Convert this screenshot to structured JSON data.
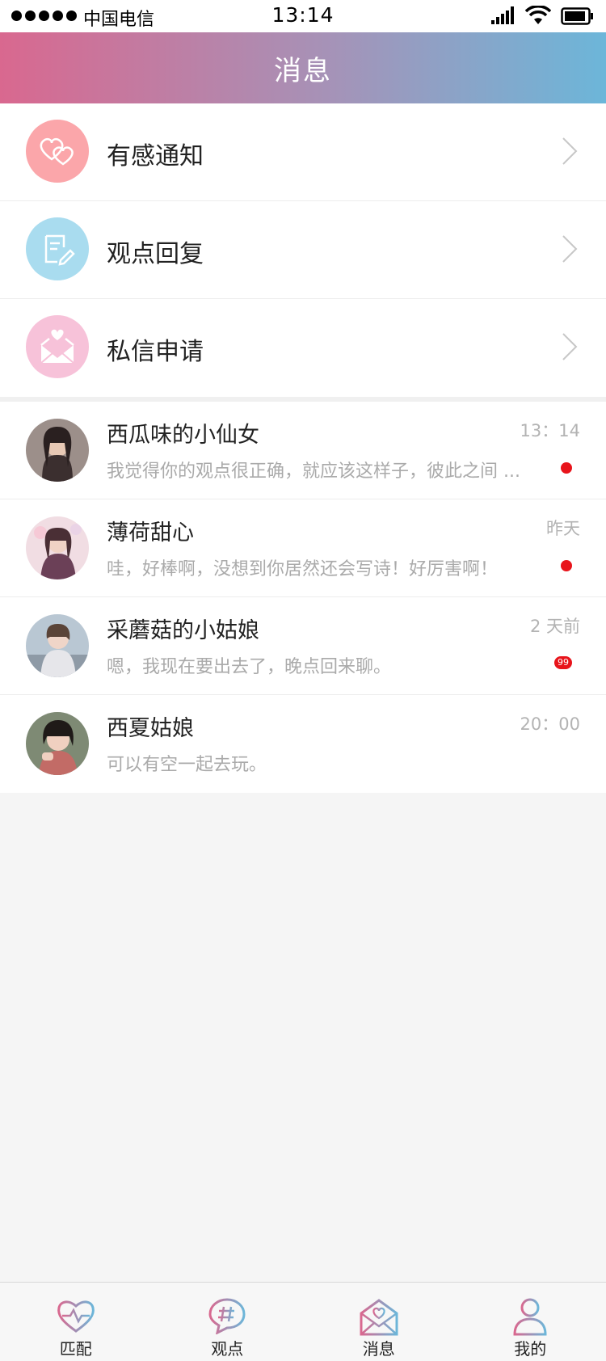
{
  "status_bar": {
    "carrier": "中国电信",
    "time": "13:14"
  },
  "header": {
    "title": "消息"
  },
  "notifications": [
    {
      "label": "有感通知",
      "icon": "hearts-icon",
      "color": "#fba6aa"
    },
    {
      "label": "观点回复",
      "icon": "note-edit-icon",
      "color": "#a9dcef"
    },
    {
      "label": "私信申请",
      "icon": "love-letter-icon",
      "color": "#f7c2d9"
    }
  ],
  "messages": [
    {
      "name": "西瓜味的小仙女",
      "preview": "我觉得你的观点很正确，就应该这样子，彼此之间 ...",
      "time": "13：14",
      "indicator": "dot"
    },
    {
      "name": "薄荷甜心",
      "preview": "哇，好棒啊，没想到你居然还会写诗！好厉害啊！",
      "time": "昨天",
      "indicator": "dot"
    },
    {
      "name": "采蘑菇的小姑娘",
      "preview": "嗯，我现在要出去了，晚点回来聊。",
      "time": "2 天前",
      "indicator": "badge",
      "badge_count": "99"
    },
    {
      "name": "西夏姑娘",
      "preview": "可以有空一起去玩。",
      "time": "20：00",
      "indicator": "none"
    }
  ],
  "tabs": [
    {
      "label": "匹配",
      "icon": "heart-pulse-icon"
    },
    {
      "label": "观点",
      "icon": "hashtag-bubble-icon"
    },
    {
      "label": "消息",
      "icon": "envelope-heart-icon"
    },
    {
      "label": "我的",
      "icon": "user-icon"
    }
  ],
  "colors": {
    "header_start": "#d9688f",
    "header_end": "#6cb6d9",
    "unread": "#e8141b"
  }
}
